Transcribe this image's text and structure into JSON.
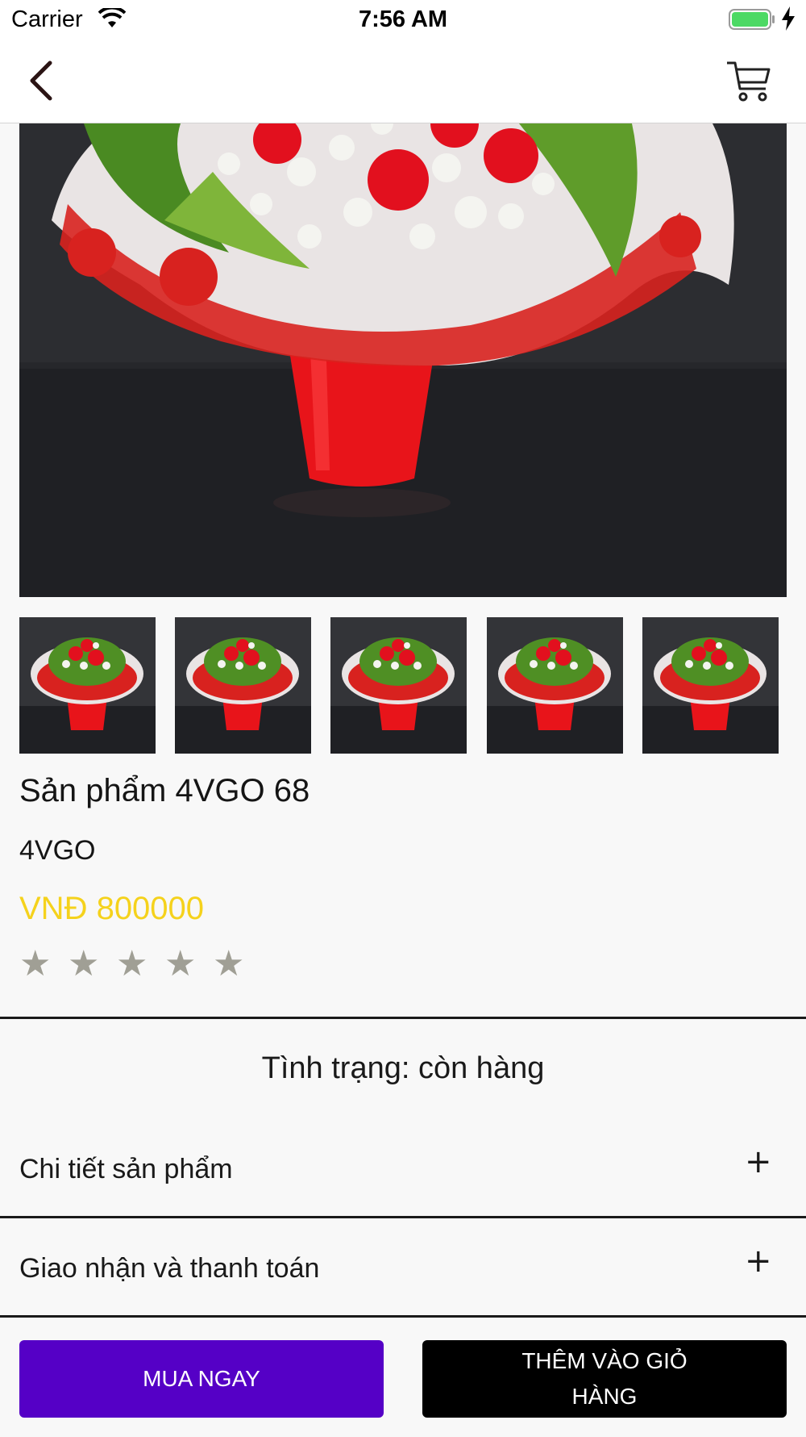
{
  "status_bar": {
    "carrier": "Carrier",
    "time": "7:56 AM",
    "wifi_icon": "wifi-icon",
    "battery_icon": "battery-charging-icon",
    "battery_color": "#4cd964"
  },
  "nav": {
    "back_icon": "chevron-left-icon",
    "cart_icon": "shopping-cart-icon"
  },
  "product": {
    "title": "Sản phẩm 4VGO 68",
    "brand": "4VGO",
    "price": "VNĐ 800000",
    "price_color": "#f5d21c",
    "rating": 0,
    "rating_max": 5,
    "stars": [
      "★",
      "★",
      "★",
      "★",
      "★"
    ],
    "thumbnail_count": 5
  },
  "availability": {
    "text": "Tình trạng: còn hàng"
  },
  "sections": [
    {
      "label": "Chi tiết sản phẩm",
      "toggle": "+"
    },
    {
      "label": "Giao nhận và thanh toán",
      "toggle": "+"
    }
  ],
  "actions": {
    "buy_now": "MUA NGAY",
    "add_to_cart": "THÊM VÀO GIỎ HÀNG",
    "buy_color": "#5500c6",
    "cart_color": "#000000"
  }
}
